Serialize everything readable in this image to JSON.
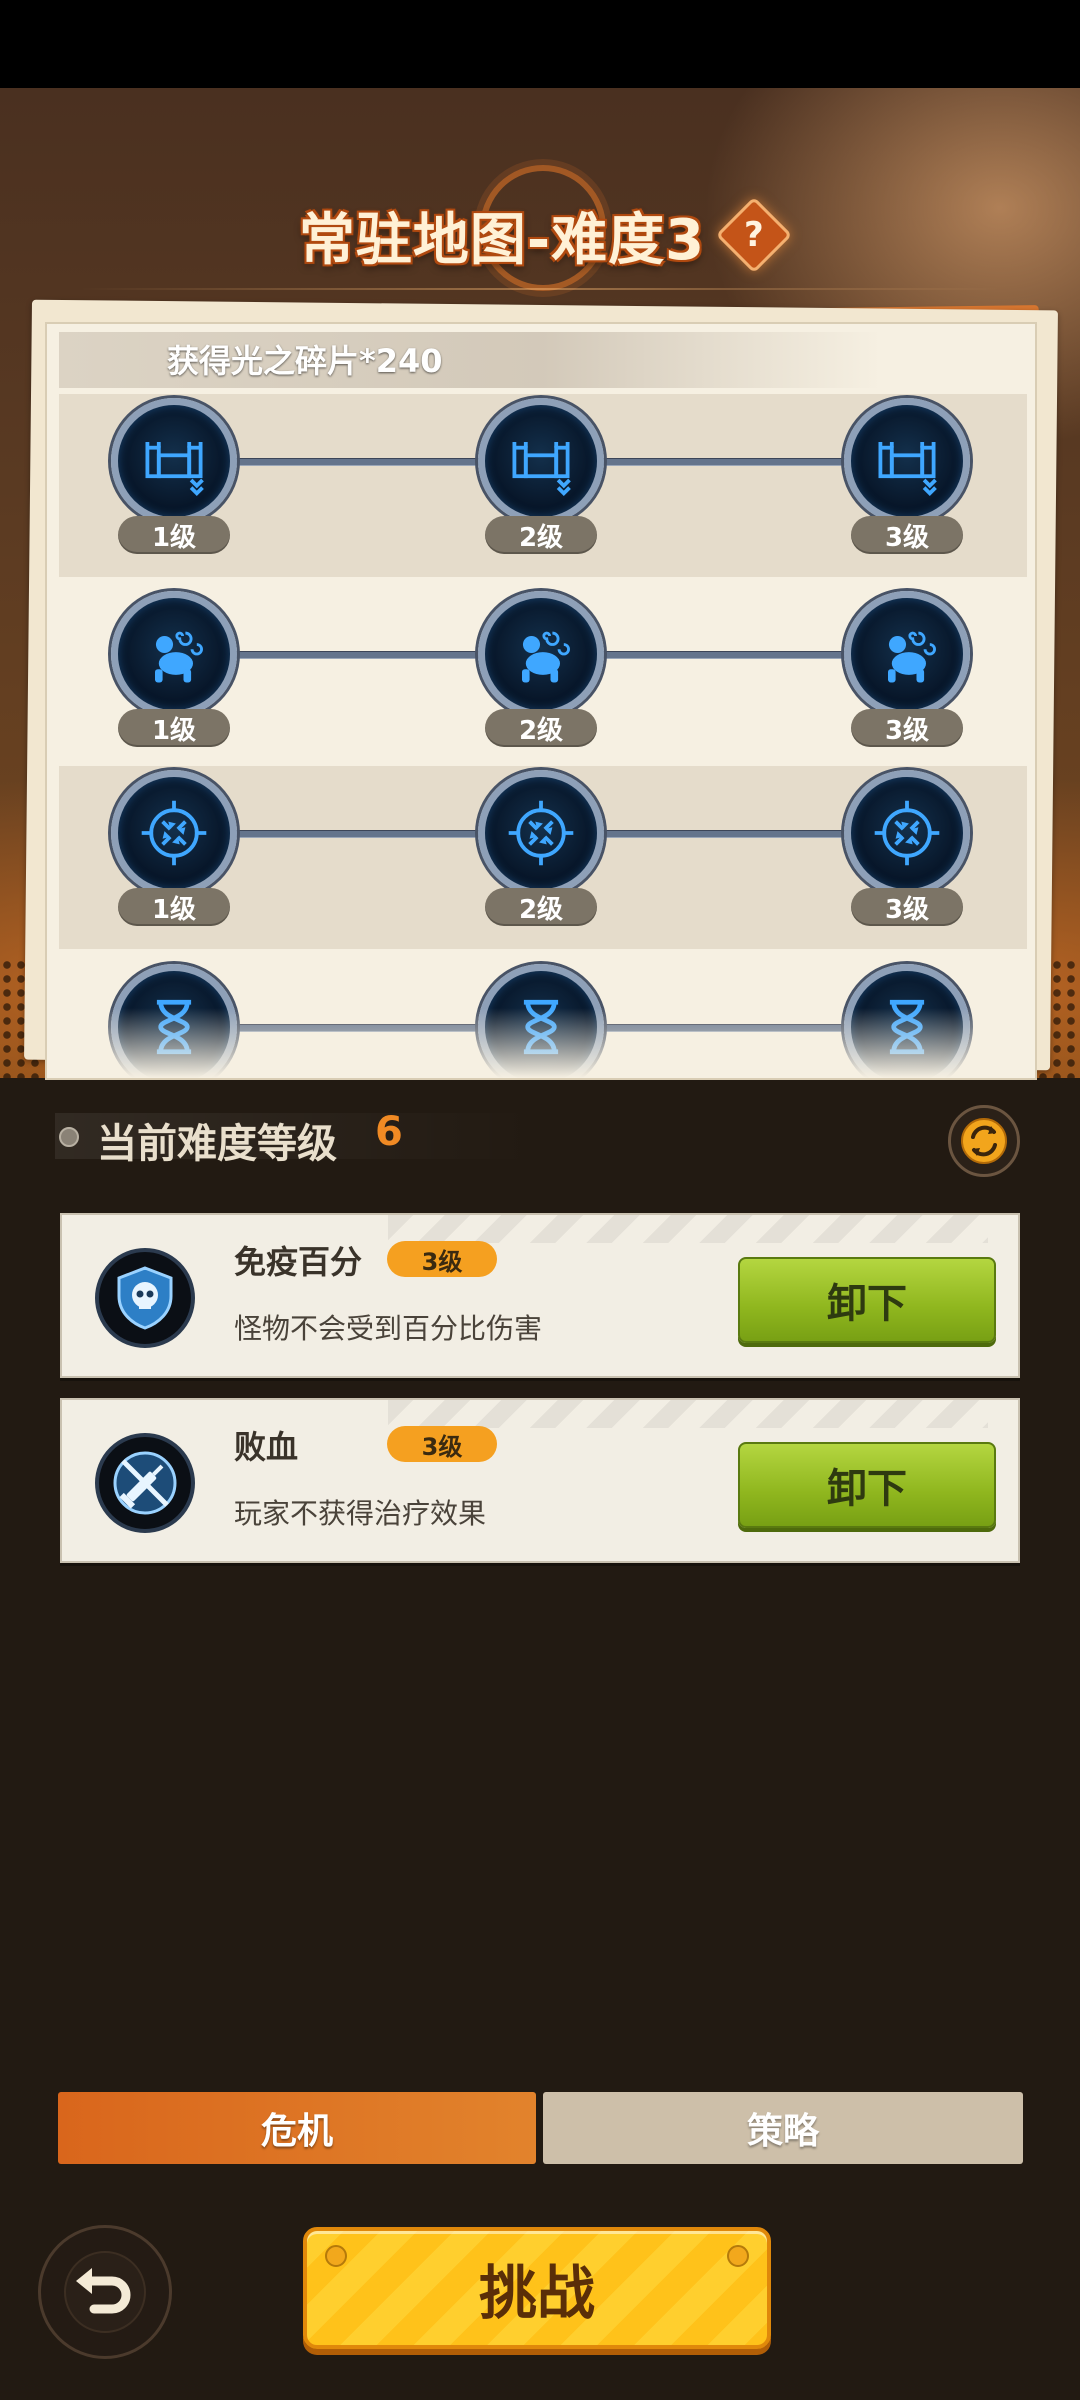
{
  "header": {
    "title": "常驻地图-难度3",
    "help_label": "?"
  },
  "panel": {
    "reward_text": "获得光之碎片*240",
    "rows": [
      {
        "icon": "fortress-down-icon",
        "levels": [
          "1级",
          "2级",
          "3级"
        ]
      },
      {
        "icon": "crouching-monkey-icon",
        "levels": [
          "1级",
          "2级",
          "3级"
        ]
      },
      {
        "icon": "crosshair-icon",
        "levels": [
          "1级",
          "2级",
          "3级"
        ]
      },
      {
        "icon": "hourglass-icon",
        "levels": []
      }
    ]
  },
  "difficulty": {
    "label": "当前难度等级",
    "value": "6"
  },
  "modifiers": [
    {
      "name": "免疫百分",
      "level": "3级",
      "description": "怪物不会受到百分比伤害",
      "icon": "skull-shield-icon",
      "action": "卸下"
    },
    {
      "name": "败血",
      "level": "3级",
      "description": "玩家不获得治疗效果",
      "icon": "no-syringe-icon",
      "action": "卸下"
    }
  ],
  "tabs": {
    "crisis": "危机",
    "strategy": "策略",
    "active": "crisis"
  },
  "footer": {
    "challenge": "挑战",
    "back_icon": "back-arrow-icon"
  },
  "colors": {
    "accent_orange": "#e2832c",
    "button_green": "#8fb61e",
    "challenge_yellow": "#ffc21a",
    "node_blue": "#3fa7ff"
  }
}
